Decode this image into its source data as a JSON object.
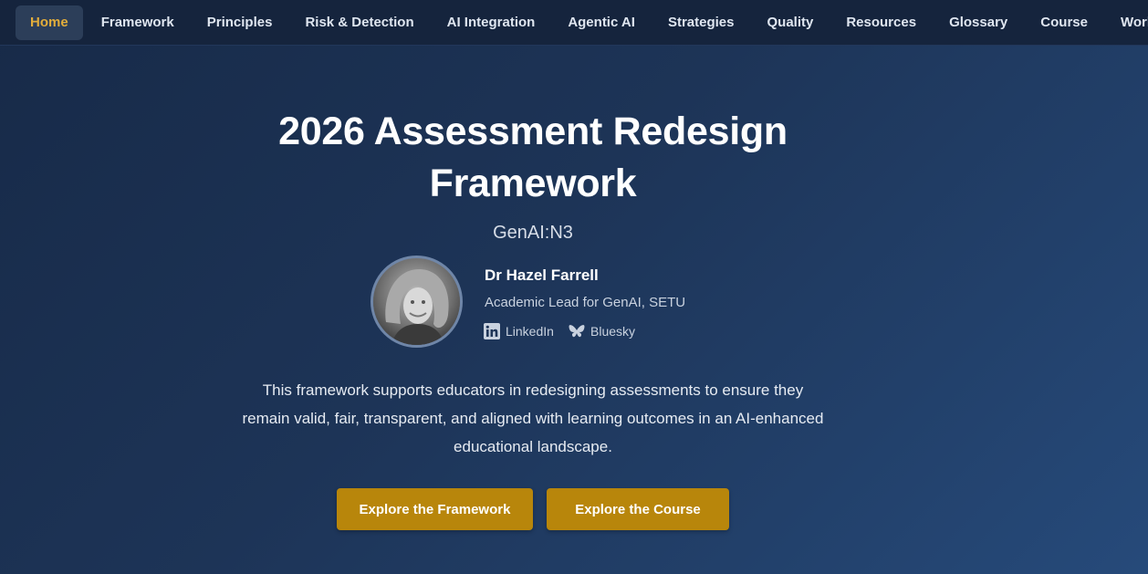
{
  "nav": {
    "items": [
      {
        "label": "Home",
        "active": true
      },
      {
        "label": "Framework"
      },
      {
        "label": "Principles"
      },
      {
        "label": "Risk & Detection"
      },
      {
        "label": "AI Integration"
      },
      {
        "label": "Agentic AI"
      },
      {
        "label": "Strategies"
      },
      {
        "label": "Quality"
      },
      {
        "label": "Resources"
      },
      {
        "label": "Glossary"
      },
      {
        "label": "Course"
      },
      {
        "label": "Workshops"
      }
    ]
  },
  "hero": {
    "title_line1": "2026 Assessment Redesign",
    "title_line2": "Framework",
    "subtitle": "GenAI:N3"
  },
  "author": {
    "name": "Dr Hazel Farrell",
    "role": "Academic Lead for GenAI, SETU",
    "links": {
      "linkedin": "LinkedIn",
      "bluesky": "Bluesky"
    }
  },
  "description": "This framework supports educators in redesigning assessments to ensure they remain valid, fair, transparent, and aligned with learning outcomes in an AI-enhanced educational landscape.",
  "buttons": {
    "framework": "Explore the Framework",
    "course": "Explore the Course"
  },
  "colors": {
    "accent": "#b8860b",
    "active_nav_text": "#e2ad3b",
    "nav_bg": "#15243d"
  }
}
